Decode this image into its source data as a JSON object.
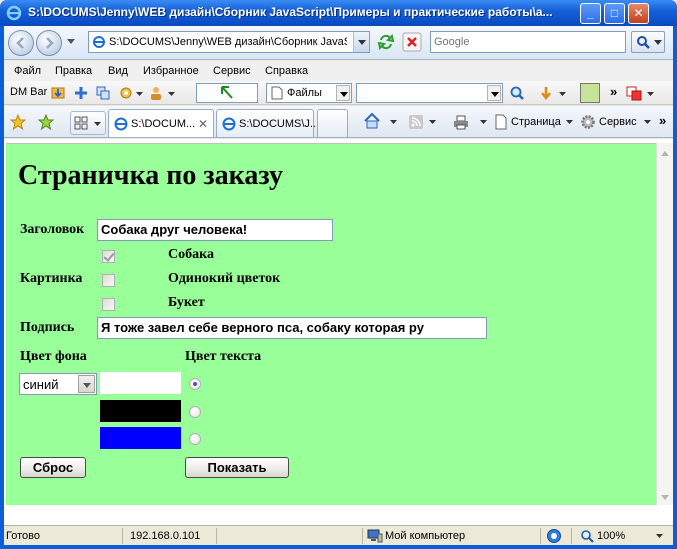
{
  "window": {
    "title": "S:\\DOCUMS\\Jenny\\WEB дизайн\\Сборник JavaScript\\Примеры и практические работы\\а...",
    "minimize": "_",
    "maximize": "□",
    "close": "✕"
  },
  "address_bar": {
    "url": "S:\\DOCUMS\\Jenny\\WEB дизайн\\Сборник JavaScr",
    "search_placeholder": "Google"
  },
  "menu": {
    "file": "Файл",
    "edit": "Правка",
    "view": "Вид",
    "favorites": "Избранное",
    "tools": "Сервис",
    "help": "Справка"
  },
  "dm_bar": {
    "label": "DM Bar",
    "files_label": "Файлы",
    "chevron": "»"
  },
  "tabs": [
    {
      "label": "S:\\DOCUM..."
    },
    {
      "label": "S:\\DOCUMS\\J..."
    }
  ],
  "command_bar": {
    "page": "Страница",
    "tools": "Сервис",
    "chevron": "»"
  },
  "page": {
    "heading": "Страничка по заказу",
    "title_label": "Заголовок",
    "title_value": "Собака друг человека!",
    "picture_label": "Картинка",
    "pictures": [
      {
        "label": "Собака",
        "checked": true
      },
      {
        "label": "Одинокий цветок",
        "checked": false
      },
      {
        "label": "Букет",
        "checked": false
      }
    ],
    "caption_label": "Подпись",
    "caption_value": "Я тоже завел себе верного пса, собаку которая ру",
    "bg_color_label": "Цвет фона",
    "text_color_label": "Цвет текста",
    "bg_select_value": "синий",
    "text_colors": [
      {
        "color": "#ffffff",
        "selected": true
      },
      {
        "color": "#000000",
        "selected": false
      },
      {
        "color": "#0000ff",
        "selected": false
      }
    ],
    "page_bg": "#99ff99",
    "reset_button": "Сброс",
    "show_button": "Показать"
  },
  "status_bar": {
    "status": "Готово",
    "ip": "192.168.0.101",
    "zone": "Мой компьютер",
    "zoom": "100%"
  }
}
